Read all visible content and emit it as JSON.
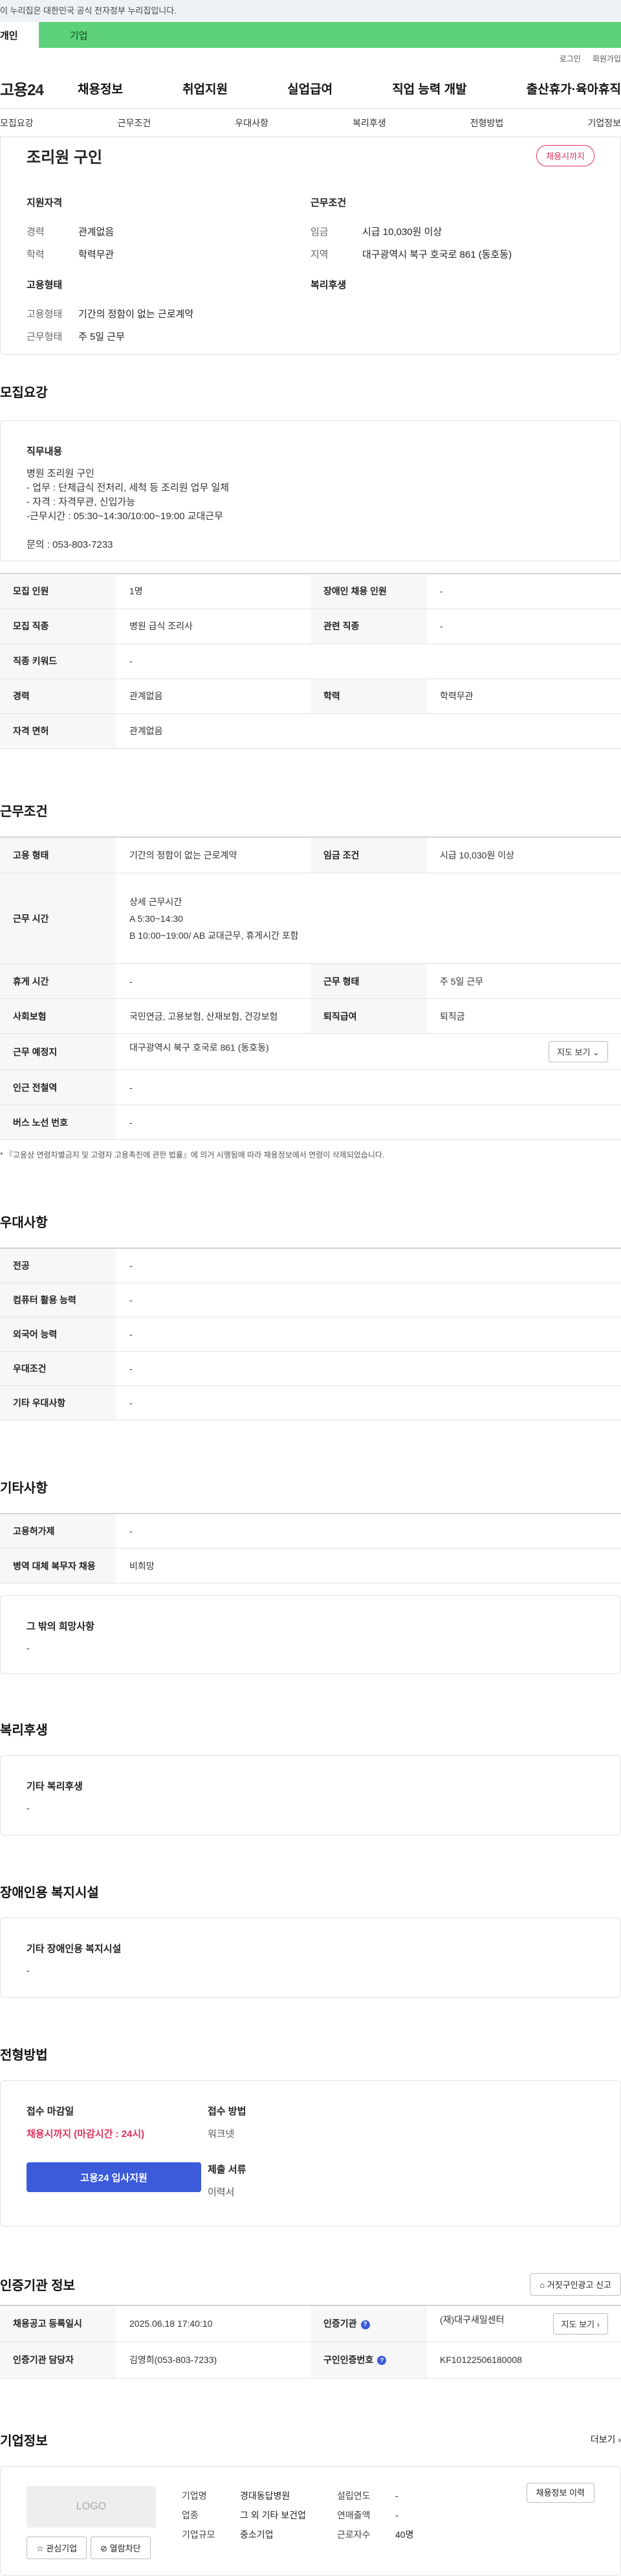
{
  "top": {
    "gov_banner": "이 누리집은 대한민국 공식 전자정부 누리집입니다.",
    "tab_personal": "개인",
    "tab_company": "기업",
    "login": "로그인",
    "signup": "회원가입"
  },
  "gnb": {
    "logo": "고용24",
    "menu": [
      "채용정보",
      "취업지원",
      "실업급여",
      "직업 능력 개발",
      "출산휴가·육아휴직"
    ]
  },
  "subnav": [
    "모집요강",
    "근무조건",
    "우대사항",
    "복리후생",
    "전형방법",
    "기업정보"
  ],
  "summary": {
    "title": "조리원 구인",
    "badge": "채용시까지",
    "qual_title": "지원자격",
    "career_k": "경력",
    "career_v": "관계없음",
    "edu_k": "학력",
    "edu_v": "학력무관",
    "emptype_title": "고용형태",
    "emptype_k": "고용형태",
    "emptype_v": "기간의 정함이 없는 근로계약",
    "worktype_k": "근무형태",
    "worktype_v": "주 5일 근무",
    "cond_title": "근무조건",
    "wage_k": "임금",
    "wage_v": "시급 10,030원 이상",
    "region_k": "지역",
    "region_v": "대구광역시 북구 호국로 861 (동호동)",
    "welfare_title": "복리후생"
  },
  "recruit": {
    "title": "모집요강",
    "duty_title": "직무내용",
    "duty_text": "병원 조리원 구인\n- 업무 : 단체급식 전처리, 세척 등 조리원 업무 일체\n- 자격 : 자격무관, 신입가능\n-근무시간 :  05:30~14:30/10:00~19:00 교대근무\n\n문의 : 053-803-7233",
    "rows": [
      [
        "모집 인원",
        "1명",
        "장애인 채용 인원",
        "-"
      ],
      [
        "모집 직종",
        "병원 급식 조리사",
        "관련 직종",
        "-"
      ],
      [
        "직종 키워드",
        "-"
      ],
      [
        "경력",
        "관계없음",
        "학력",
        "학력무관"
      ],
      [
        "자격 면허",
        "관계없음"
      ]
    ]
  },
  "work": {
    "title": "근무조건",
    "emp_k": "고용 형태",
    "emp_v": "기간의 정함이 없는 근로계약",
    "wage_k": "임금 조건",
    "wage_v": "시급 10,030원 이상",
    "hours_k": "근무 시간",
    "hours_lines": [
      "상세 근무시간",
      "A 5:30~14:30",
      "B 10:00~19:00/ AB 교대근무, 휴게시간 포함"
    ],
    "break_k": "휴게 시간",
    "break_v": "-",
    "form_k": "근무 형태",
    "form_v": "주 5일 근무",
    "ins_k": "사회보험",
    "ins_v": "국민연금, 고용보험, 산재보험, 건강보험",
    "sev_k": "퇴직급여",
    "sev_v": "퇴직금",
    "place_k": "근무 예정지",
    "place_v": "대구광역시 북구 호국로 861 (동호동)",
    "map_btn": "지도 보기",
    "subway_k": "인근 전철역",
    "subway_v": "-",
    "bus_k": "버스 노선 번호",
    "bus_v": "-",
    "note": "* 『고용상 연령차별금지 및 고령자 고용촉진에 관한 법률』에 의거 시행됨에 따라 채용정보에서 연령이 삭제되었습니다."
  },
  "prefer": {
    "title": "우대사항",
    "rows": [
      [
        "전공",
        "-"
      ],
      [
        "컴퓨터 활용 능력",
        "-"
      ],
      [
        "외국어 능력",
        "-"
      ],
      [
        "우대조건",
        "-"
      ],
      [
        "기타 우대사항",
        "-"
      ]
    ]
  },
  "etc": {
    "title": "기타사항",
    "rows": [
      [
        "고용허가제",
        "-"
      ],
      [
        "병역 대체 복무자 채용",
        "비희망"
      ]
    ],
    "box_title": "그 밖의 희망사항",
    "box_val": "-"
  },
  "welfare": {
    "title": "복리후생",
    "box_title": "기타 복리후생",
    "box_val": "-"
  },
  "disabled": {
    "title": "장애인용 복지시설",
    "box_title": "기타 장애인용 복지시설",
    "box_val": "-"
  },
  "process": {
    "title": "전형방법",
    "deadline_k": "접수 마감일",
    "deadline_v": "채용시까지 (마감시간 : 24시)",
    "apply_btn": "고용24 입사지원",
    "method_k": "접수 방법",
    "method_v": "워크넷",
    "docs_k": "제출 서류",
    "docs_v": "이력서"
  },
  "cert": {
    "title": "인증기관 정보",
    "report_btn": "거짓구인광고 신고",
    "reg_k": "채용공고 등록일시",
    "reg_v": "2025.06.18 17:40:10",
    "org_k": "인증기관",
    "org_v": "(재)대구새일센터",
    "map_btn": "지도 보기",
    "mgr_k": "인증기관 담당자",
    "mgr_v": "김영희(053-803-7233)",
    "no_k": "구인인증번호",
    "no_v": "KF10122506180008"
  },
  "company": {
    "title": "기업정보",
    "more": "더보기",
    "logo": "LOGO",
    "fav_btn": "관심기업",
    "block_btn": "열람차단",
    "name_k": "기업명",
    "name_v": "경대동답병원",
    "year_k": "설립연도",
    "year_v": "-",
    "ind_k": "업종",
    "ind_v": "그 외 기타 보건업",
    "sales_k": "연매출액",
    "sales_v": "-",
    "size_k": "기업규모",
    "size_v": "중소기업",
    "emp_k": "근로자수",
    "emp_v": "40명",
    "history_btn": "채용정보 이력"
  }
}
